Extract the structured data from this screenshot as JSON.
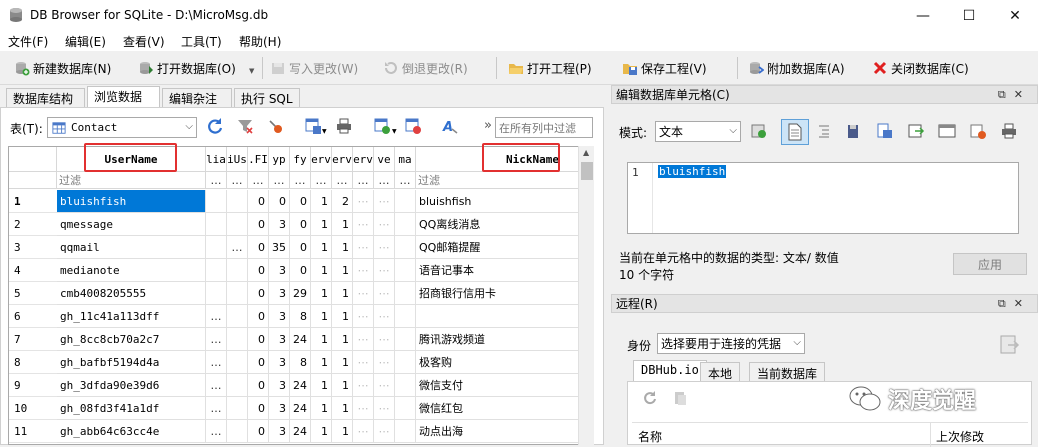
{
  "window": {
    "title": "DB Browser for SQLite - D:\\MicroMsg.db",
    "minimize": "—",
    "maximize": "☐",
    "close": "✕"
  },
  "menu": [
    "文件(F)",
    "编辑(E)",
    "查看(V)",
    "工具(T)",
    "帮助(H)"
  ],
  "toolbar": {
    "new_db": "新建数据库(N)",
    "open_db": "打开数据库(O)",
    "write_changes": "写入更改(W)",
    "revert_changes": "倒退更改(R)",
    "open_project": "打开工程(P)",
    "save_project": "保存工程(V)",
    "attach_db": "附加数据库(A)",
    "close_db": "关闭数据库(C)"
  },
  "tabs": [
    "数据库结构",
    "浏览数据",
    "编辑杂注",
    "执行 SQL"
  ],
  "browse": {
    "table_label": "表(T):",
    "table_value": "Contact",
    "filter_all_placeholder": "在所有列中过滤",
    "more": "»",
    "filter_placeholder": "过滤",
    "columns": [
      "UserName",
      "lia",
      "iUs",
      ".FI",
      "yp",
      "fy",
      "erv",
      "erv",
      "erv",
      "ve",
      "ma",
      "NickName"
    ],
    "rows": [
      {
        "n": "1",
        "user": "bluishfish",
        "c1": "",
        "c2": "",
        "c3": "0",
        "c4": "0",
        "c5": "0",
        "c6": "1",
        "c7": "2",
        "nick": "bluishfish"
      },
      {
        "n": "2",
        "user": "qmessage",
        "c1": "",
        "c2": "",
        "c3": "0",
        "c4": "3",
        "c5": "0",
        "c6": "1",
        "c7": "1",
        "nick": "QQ离线消息"
      },
      {
        "n": "3",
        "user": "qqmail",
        "c1": "",
        "c2": "…",
        "c3": "0",
        "c4": "35",
        "c5": "0",
        "c6": "1",
        "c7": "1",
        "nick": "QQ邮箱提醒"
      },
      {
        "n": "4",
        "user": "medianote",
        "c1": "",
        "c2": "",
        "c3": "0",
        "c4": "3",
        "c5": "0",
        "c6": "1",
        "c7": "1",
        "nick": "语音记事本"
      },
      {
        "n": "5",
        "user": "cmb4008205555",
        "c1": "",
        "c2": "",
        "c3": "0",
        "c4": "3",
        "c5": "29",
        "c6": "1",
        "c7": "1",
        "nick": "招商银行信用卡"
      },
      {
        "n": "6",
        "user": "gh_11c41a113dff",
        "c1": "…",
        "c2": "",
        "c3": "0",
        "c4": "3",
        "c5": "8",
        "c6": "1",
        "c7": "1",
        "nick": ""
      },
      {
        "n": "7",
        "user": "gh_8cc8cb70a2c7",
        "c1": "…",
        "c2": "",
        "c3": "0",
        "c4": "3",
        "c5": "24",
        "c6": "1",
        "c7": "1",
        "nick": "腾讯游戏频道"
      },
      {
        "n": "8",
        "user": "gh_bafbf5194d4a",
        "c1": "…",
        "c2": "",
        "c3": "0",
        "c4": "3",
        "c5": "8",
        "c6": "1",
        "c7": "1",
        "nick": "极客购"
      },
      {
        "n": "9",
        "user": "gh_3dfda90e39d6",
        "c1": "…",
        "c2": "",
        "c3": "0",
        "c4": "3",
        "c5": "24",
        "c6": "1",
        "c7": "1",
        "nick": "微信支付"
      },
      {
        "n": "10",
        "user": "gh_08fd3f41a1df",
        "c1": "…",
        "c2": "",
        "c3": "0",
        "c4": "3",
        "c5": "24",
        "c6": "1",
        "c7": "1",
        "nick": "微信红包"
      },
      {
        "n": "11",
        "user": "gh_abb64c63cc4e",
        "c1": "…",
        "c2": "",
        "c3": "0",
        "c4": "3",
        "c5": "24",
        "c6": "1",
        "c7": "1",
        "nick": "动点出海"
      }
    ]
  },
  "cell_editor": {
    "title": "编辑数据库单元格(C)",
    "mode_label": "模式:",
    "mode_value": "文本",
    "line_no": "1",
    "content": "bluishfish",
    "type_info": "当前在单元格中的数据的类型: 文本/ 数值",
    "size_info": "10 个字符",
    "apply": "应用"
  },
  "remote": {
    "title": "远程(R)",
    "identity_label": "身份",
    "identity_value": "选择要用于连接的凭据",
    "tabs": [
      "DBHub.io",
      "本地",
      "当前数据库"
    ],
    "col_name": "名称",
    "col_modified": "上次修改"
  },
  "watermark": "深度觉醒",
  "colors": {
    "selection": "#0078d7",
    "highlight_box": "#e23030"
  }
}
